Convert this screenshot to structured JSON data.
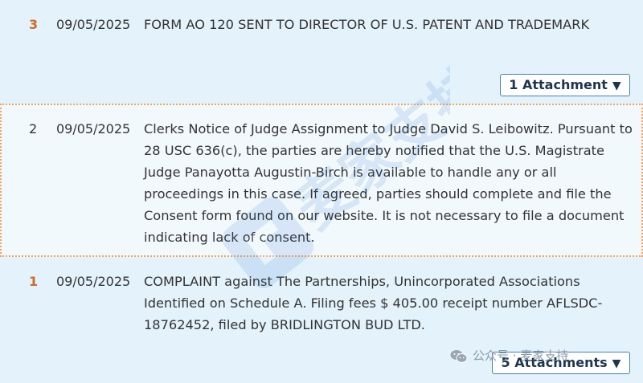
{
  "entries": [
    {
      "number": "3",
      "date": "09/05/2025",
      "text": "FORM AO 120 SENT TO DIRECTOR OF U.S. PATENT AND TRADEMARK",
      "attachments_label": "1 Attachment"
    },
    {
      "number": "2",
      "date": "09/05/2025",
      "text": "Clerks Notice of Judge Assignment to Judge David S. Leibowitz. Pursuant to 28 USC 636(c), the parties are hereby notified that the U.S. Magistrate Judge Panayotta Augustin-Birch is available to handle any or all proceedings in this case. If agreed, parties should complete and file the Consent form found on our website. It is not necessary to file a document indicating lack of consent."
    },
    {
      "number": "1",
      "date": "09/05/2025",
      "text": "COMPLAINT against The Partnerships, Unincorporated Associations Identified on Schedule A. Filing fees $ 405.00 receipt number AFLSDC-18762452, filed by BRIDLINGTON BUD LTD.",
      "attachments_label": "5 Attachments"
    }
  ],
  "caret": "▼",
  "watermark": {
    "text": "麦家支持",
    "footer_text": "公众号 · 麦家支持",
    "icon": "wechat-icon"
  },
  "colors": {
    "link_number": "#cf6b27",
    "row_bg": "#e3f2fb",
    "row_bg_selected": "#f1f9fd",
    "selected_border": "#f2a25f",
    "button_border": "#4a7fb0"
  }
}
